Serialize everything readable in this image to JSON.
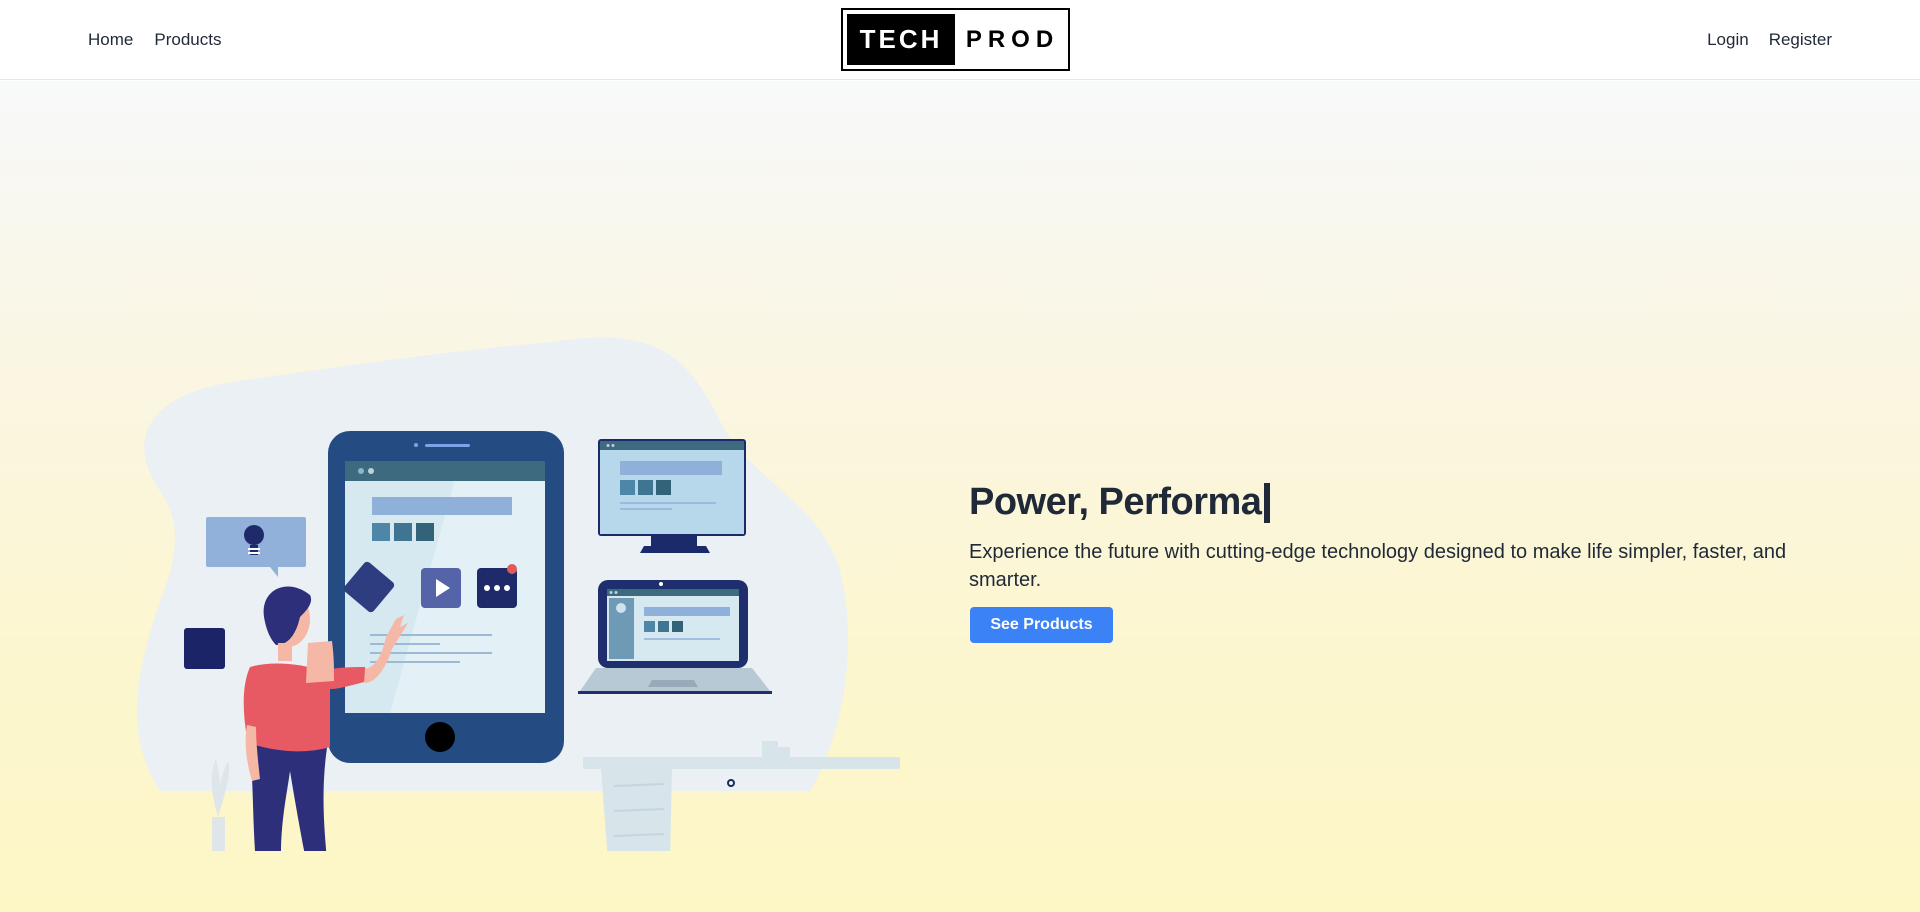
{
  "nav": {
    "home": "Home",
    "products": "Products",
    "login": "Login",
    "register": "Register"
  },
  "logo": {
    "left": "TECH",
    "right": "PROD"
  },
  "hero": {
    "headline": "Power, Performa",
    "subtitle": "Experience the future with cutting-edge technology designed to make life simpler, faster, and smarter.",
    "cta_label": "See Products"
  },
  "colors": {
    "accent": "#3b82f6",
    "navy": "#244b82",
    "person_shirt": "#e85a63",
    "person_pants": "#2e2f7a"
  }
}
